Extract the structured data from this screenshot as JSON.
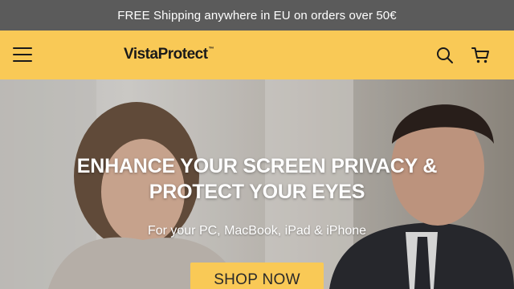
{
  "announcement": {
    "text": "FREE Shipping anywhere in EU on orders over 50€"
  },
  "header": {
    "logo_text": "VistaProtect",
    "logo_mark": "™",
    "icons": {
      "menu": "hamburger-menu-icon",
      "search": "search-icon",
      "cart": "cart-icon"
    }
  },
  "hero": {
    "title": "ENHANCE YOUR SCREEN PRIVACY & PROTECT YOUR EYES",
    "subtitle": "For your PC, MacBook, iPad & iPhone",
    "cta_label": "SHOP NOW"
  },
  "colors": {
    "announcement_bg": "#5b5b5b",
    "brand_yellow": "#f9c956",
    "text_dark": "#1a1a1a"
  }
}
